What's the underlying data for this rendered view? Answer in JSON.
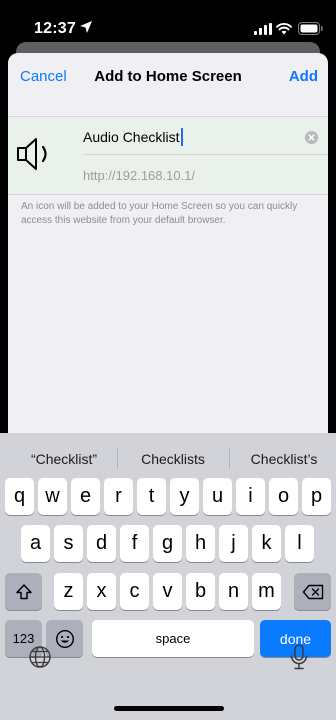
{
  "status_bar": {
    "time": "12:37"
  },
  "nav": {
    "cancel": "Cancel",
    "title": "Add to Home Screen",
    "add": "Add"
  },
  "shortcut": {
    "name": "Audio Checklist",
    "url": "http://192.168.10.1/",
    "icon": "speaker-icon"
  },
  "helper_text": "An icon will be added to your Home Screen so you can quickly access this website from your default browser.",
  "keyboard": {
    "suggestions": [
      "“Checklist”",
      "Checklists",
      "Checklist’s"
    ],
    "row1": [
      "q",
      "w",
      "e",
      "r",
      "t",
      "y",
      "u",
      "i",
      "o",
      "p"
    ],
    "row2": [
      "a",
      "s",
      "d",
      "f",
      "g",
      "h",
      "j",
      "k",
      "l"
    ],
    "row3": [
      "z",
      "x",
      "c",
      "v",
      "b",
      "n",
      "m"
    ],
    "numbers_key": "123",
    "space_key": "space",
    "done_key": "done"
  },
  "colors": {
    "accent": "#0a7aff",
    "sheet_bg": "#efeff4",
    "keyboard_bg": "#d1d3d9"
  }
}
